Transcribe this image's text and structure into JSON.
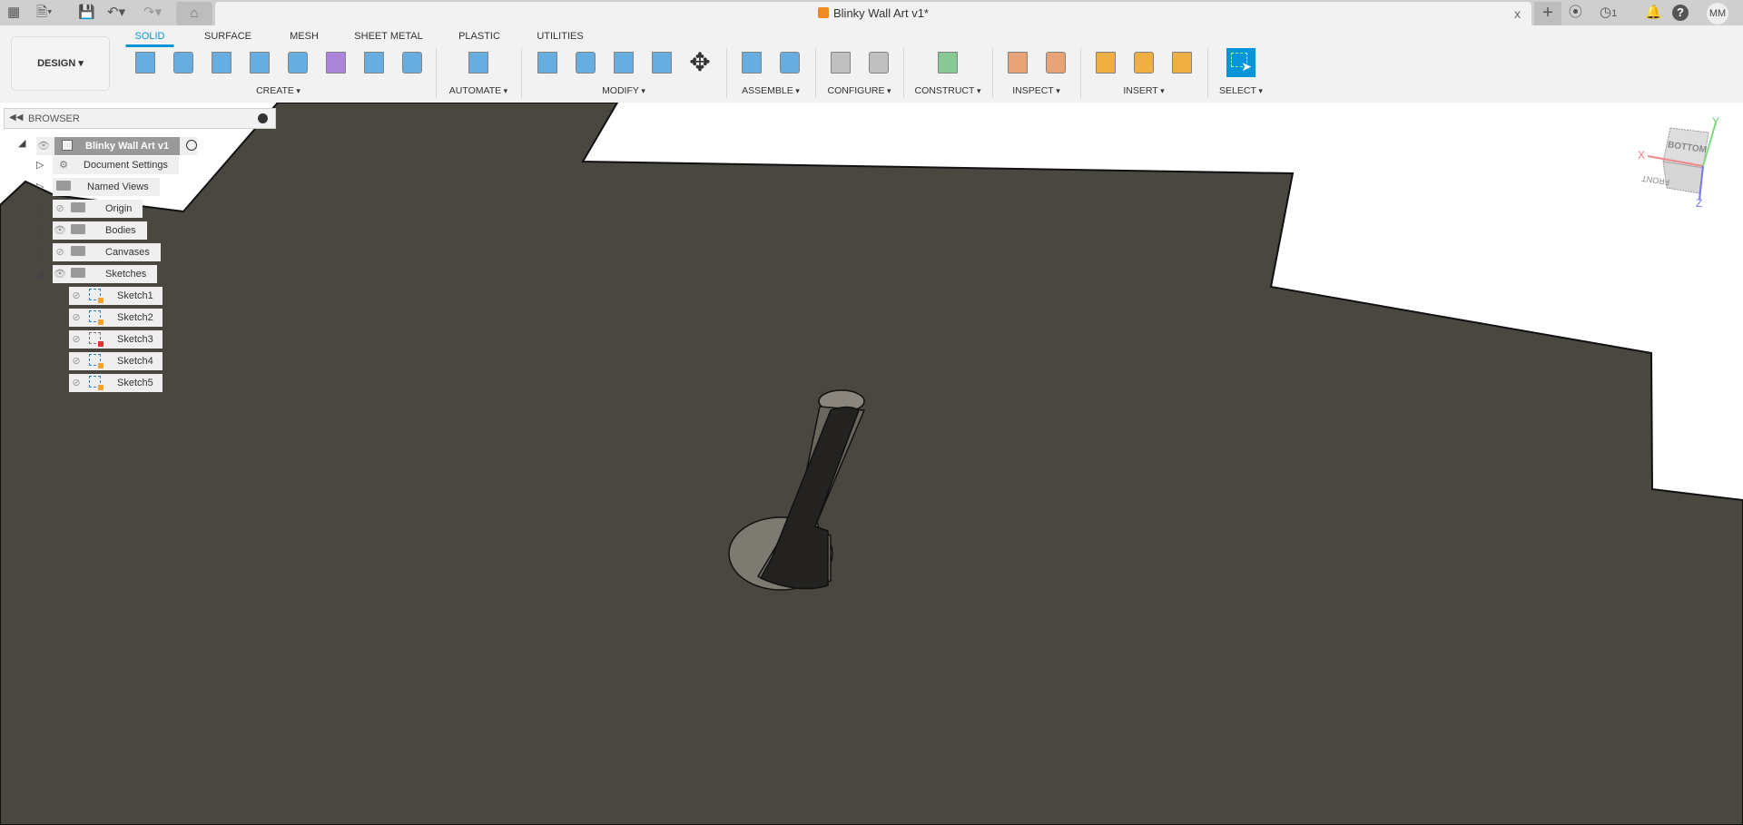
{
  "topbar": {
    "document_title": "Blinky Wall Art v1*",
    "close": "x",
    "jobs_count": "1",
    "user_initials": "MM"
  },
  "ribbon": {
    "workspace": "DESIGN",
    "tabs": [
      {
        "label": "SOLID",
        "active": true
      },
      {
        "label": "SURFACE"
      },
      {
        "label": "MESH"
      },
      {
        "label": "SHEET METAL"
      },
      {
        "label": "PLASTIC"
      },
      {
        "label": "UTILITIES"
      }
    ],
    "groups": [
      {
        "label": "CREATE",
        "icons": [
          "create-sketch-icon",
          "extrude-icon",
          "revolve-icon",
          "hole-icon",
          "rectangular-pattern-icon",
          "form-icon",
          "circular-pattern-icon",
          "loft-icon"
        ]
      },
      {
        "label": "AUTOMATE",
        "icons": [
          "automate-icon"
        ]
      },
      {
        "label": "MODIFY",
        "icons": [
          "press-pull-icon",
          "shell-icon",
          "combine-icon",
          "split-icon",
          "move-icon"
        ]
      },
      {
        "label": "ASSEMBLE",
        "icons": [
          "new-component-icon",
          "joint-icon"
        ]
      },
      {
        "label": "CONFIGURE",
        "icons": [
          "configure-icon",
          "parameters-table-icon"
        ]
      },
      {
        "label": "CONSTRUCT",
        "icons": [
          "offset-plane-icon"
        ]
      },
      {
        "label": "INSPECT",
        "icons": [
          "analysis-icon",
          "measure-icon"
        ]
      },
      {
        "label": "INSERT",
        "icons": [
          "insert-svg-icon",
          "insert-mcmaster-icon",
          "insert-canvas-icon"
        ]
      },
      {
        "label": "SELECT",
        "icons": [
          "select-icon"
        ]
      }
    ]
  },
  "browser": {
    "title": "BROWSER",
    "root": "Blinky Wall Art v1",
    "items": [
      {
        "label": "Document Settings"
      },
      {
        "label": "Named Views"
      },
      {
        "label": "Origin"
      },
      {
        "label": "Bodies"
      },
      {
        "label": "Canvases"
      },
      {
        "label": "Sketches"
      }
    ],
    "sketches": [
      "Sketch1",
      "Sketch2",
      "Sketch3",
      "Sketch4",
      "Sketch5"
    ]
  },
  "viewcube": {
    "top_face": "BOTTOM",
    "front_face": "FRONT",
    "x": "X",
    "y": "Y",
    "z": "Z"
  },
  "colors": {
    "accent": "#0696d7",
    "model": "#4a4741",
    "background": "#ffffff"
  }
}
